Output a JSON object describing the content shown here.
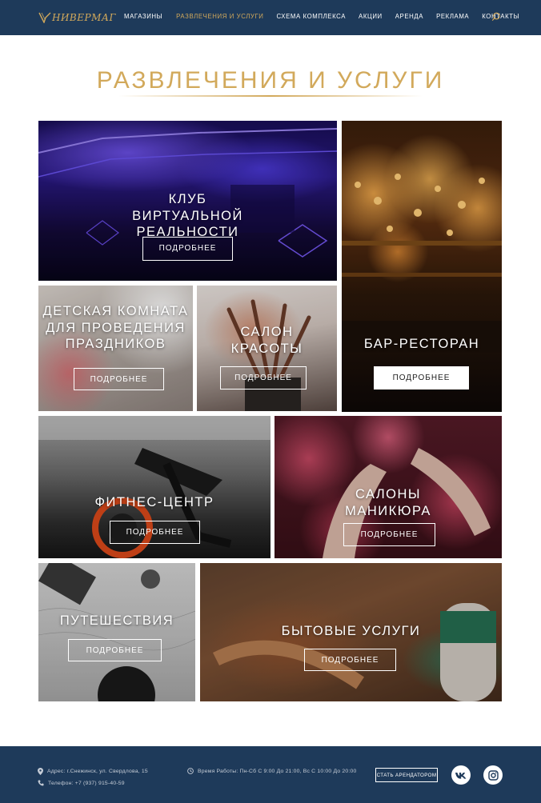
{
  "header": {
    "logo_text": "НИВЕРМАГ",
    "nav": [
      {
        "label": "МАГАЗИНЫ",
        "active": false
      },
      {
        "label": "РАЗВЛЕЧЕНИЯ И УСЛУГИ",
        "active": true
      },
      {
        "label": "СХЕМА КОМПЛЕКСА",
        "active": false
      },
      {
        "label": "АКЦИИ",
        "active": false
      },
      {
        "label": "АРЕНДА",
        "active": false
      },
      {
        "label": "РЕКЛАМА",
        "active": false
      },
      {
        "label": "КОНТАКТЫ",
        "active": false
      }
    ]
  },
  "page": {
    "title": "РАЗВЛЕЧЕНИЯ И УСЛУГИ"
  },
  "tiles": [
    {
      "title": "КЛУБ ВИРТУАЛЬНОЙ РЕАЛЬНОСТИ",
      "button": "ПОДРОБНЕЕ"
    },
    {
      "title": "БАР-РЕСТОРАН",
      "button": "ПОДРОБНЕЕ"
    },
    {
      "title": "ДЕТСКАЯ КОМНАТА ДЛЯ ПРОВЕДЕНИЯ ПРАЗДНИКОВ",
      "button": "ПОДРОБНЕЕ"
    },
    {
      "title": "САЛОН КРАСОТЫ",
      "button": "ПОДРОБНЕЕ"
    },
    {
      "title": "ФИТНЕС-ЦЕНТР",
      "button": "ПОДРОБНЕЕ"
    },
    {
      "title": "САЛОНЫ МАНИКЮРА",
      "button": "ПОДРОБНЕЕ"
    },
    {
      "title": "ПУТЕШЕСТВИЯ",
      "button": "ПОДРОБНЕЕ"
    },
    {
      "title": "БЫТОВЫЕ УСЛУГИ",
      "button": "ПОДРОБНЕЕ"
    }
  ],
  "footer": {
    "address": "Адрес: г.Снежинск, ул. Свердлова, 15",
    "phone": "Телефон: +7 (937) 915-40-59",
    "hours": "Время Работы: Пн-Сб С 9:00 До 21:00,  Вс  С 10:00 До 20:00",
    "cta": "СТАТЬ АРЕНДАТОРОМ",
    "social": [
      "vk-icon",
      "instagram-icon"
    ]
  },
  "colors": {
    "navy": "#1e3a5a",
    "gold": "#d2a95b",
    "white": "#ffffff"
  }
}
